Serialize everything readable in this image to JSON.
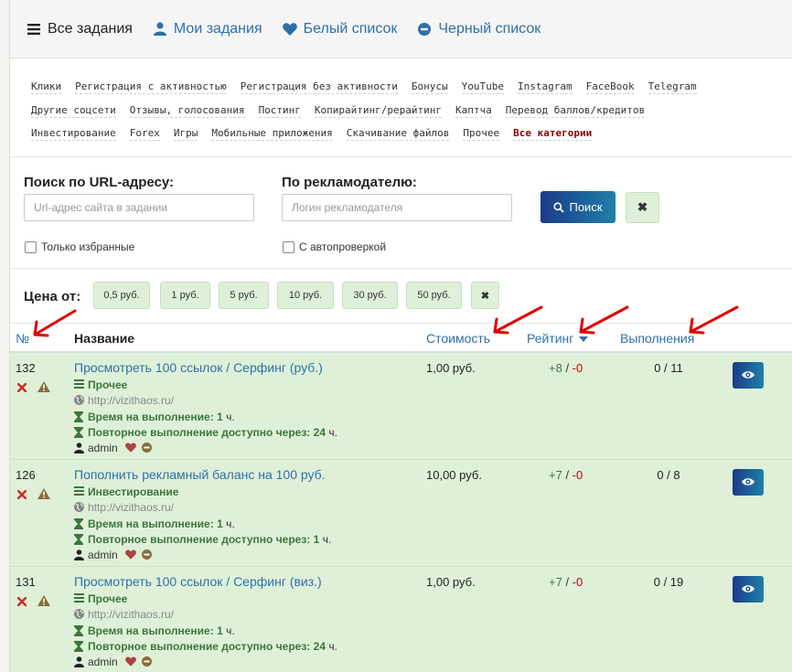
{
  "tabs": [
    {
      "label": "Все задания",
      "icon": "bars-icon"
    },
    {
      "label": "Мои задания",
      "icon": "user-icon"
    },
    {
      "label": "Белый список",
      "icon": "heart-icon"
    },
    {
      "label": "Черный список",
      "icon": "minus-circle-icon"
    }
  ],
  "categories": [
    [
      "Клики",
      "Регистрация с активностью",
      "Регистрация без активности",
      "Бонусы",
      "YouTube",
      "Instagram",
      "FaceBook",
      "Telegram"
    ],
    [
      "Другие соцсети",
      "Отзывы, голосования",
      "Постинг",
      "Копирайтинг/рерайтинг",
      "Каптча",
      "Перевод баллов/кредитов"
    ],
    [
      "Инвестирование",
      "Forex",
      "Игры",
      "Мобильные приложения",
      "Скачивание файлов",
      "Прочее",
      "Все категории"
    ]
  ],
  "search": {
    "url_label": "Поиск по URL-адресу:",
    "url_placeholder": "Url-адрес сайта в задании",
    "adv_label": "По рекламодателю:",
    "adv_placeholder": "Логин рекламодателя",
    "search_button": "Поиск",
    "clear_button": "✖",
    "fav_only": "Только избранные",
    "autocheck": "С автопроверкой"
  },
  "price": {
    "label": "Цена от:",
    "options": [
      "0,5 руб.",
      "1 руб.",
      "5 руб.",
      "10 руб.",
      "30 руб.",
      "50 руб."
    ],
    "clear": "✖"
  },
  "table": {
    "headers": {
      "num": "№",
      "name": "Название",
      "cost": "Стоимость",
      "rating": "Рейтинг",
      "done": "Выполнения"
    },
    "rows": [
      {
        "id": "132",
        "title": "Просмотреть 100 ссылок / Серфинг (руб.)",
        "category": "Прочее",
        "url": "http://vizithaos.ru/",
        "time_label": "Время на выполнение:",
        "time_value": "1",
        "time_unit": "ч.",
        "repeat_label": "Повторное выполнение доступно через:",
        "repeat_value": "24",
        "repeat_unit": "ч.",
        "author": "admin",
        "cost": "1,00 руб.",
        "rating_pos": "+8",
        "rating_neg": "-0",
        "done": "0 / 11"
      },
      {
        "id": "126",
        "title": "Пополнить рекламный баланс на 100 руб.",
        "category": "Инвестирование",
        "url": "http://vizithaos.ru/",
        "time_label": "Время на выполнение:",
        "time_value": "1",
        "time_unit": "ч.",
        "repeat_label": "Повторное выполнение доступно через:",
        "repeat_value": "1",
        "repeat_unit": "ч.",
        "author": "admin",
        "cost": "10,00 руб.",
        "rating_pos": "+7",
        "rating_neg": "-0",
        "done": "0 / 8"
      },
      {
        "id": "131",
        "title": "Просмотреть 100 ссылок / Серфинг (виз.)",
        "category": "Прочее",
        "url": "http://vizithaos.ru/",
        "time_label": "Время на выполнение:",
        "time_value": "1",
        "time_unit": "ч.",
        "repeat_label": "Повторное выполнение доступно через:",
        "repeat_value": "24",
        "repeat_unit": "ч.",
        "author": "admin",
        "cost": "1,00 руб.",
        "rating_pos": "+7",
        "rating_neg": "-0",
        "done": "0 / 19"
      }
    ]
  },
  "colors": {
    "accent": "#2f6fa8",
    "row_bg": "#dff0d8",
    "annotation_arrow": "#e00000"
  }
}
